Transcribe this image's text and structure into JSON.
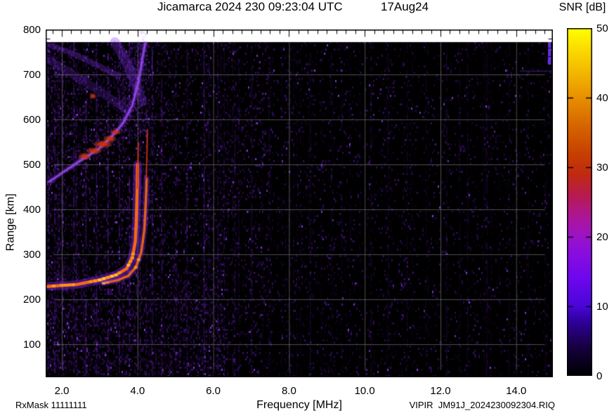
{
  "header": {
    "title": "Jicamarca 2024 230 09:23:04 UTC",
    "date": "17Aug24"
  },
  "footer": {
    "left": "RxMask 11111111",
    "right": "VIPIR  JM91J_2024230092304.RIQ"
  },
  "axes": {
    "x_label": "Frequency [MHz]",
    "y_label": "Range [km]",
    "x_tick_values": [
      2,
      4,
      6,
      8,
      10,
      12,
      14
    ],
    "x_tick_labels": [
      "2.0",
      "4.0",
      "6.0",
      "8.0",
      "10.0",
      "12.0",
      "14.0"
    ],
    "y_tick_values": [
      100,
      200,
      300,
      400,
      500,
      600,
      700,
      800
    ],
    "y_tick_labels": [
      "100",
      "200",
      "300",
      "400",
      "500",
      "600",
      "700",
      "800"
    ],
    "x_range_mhz": [
      1.57,
      14.97
    ],
    "y_range_km": [
      26.6,
      800
    ],
    "grid_color": "#7a7a7a"
  },
  "colorbar": {
    "title": "SNR [dB]",
    "min": 0,
    "max": 50,
    "tick_values": [
      0,
      10,
      20,
      30,
      40,
      50
    ],
    "tick_labels": [
      "0",
      "10",
      "20",
      "30",
      "40",
      "50"
    ],
    "palette": [
      [
        0,
        "#000000"
      ],
      [
        4,
        "#16003e"
      ],
      [
        8,
        "#31019f"
      ],
      [
        10,
        "#4a06d8"
      ],
      [
        14,
        "#6e07ee"
      ],
      [
        18,
        "#8b0edd"
      ],
      [
        20,
        "#9c13c6"
      ],
      [
        23,
        "#ad1694"
      ],
      [
        26,
        "#b81b4e"
      ],
      [
        29,
        "#c02a10"
      ],
      [
        32,
        "#c74000"
      ],
      [
        36,
        "#d66600"
      ],
      [
        40,
        "#e89000"
      ],
      [
        44,
        "#f4bc00"
      ],
      [
        47,
        "#fbdc00"
      ],
      [
        50,
        "#ffff00"
      ]
    ]
  },
  "chart_data": {
    "type": "heatmap",
    "title": "Jicamarca 2024 230 09:23:04 UTC",
    "x_unit": "MHz",
    "y_unit": "km",
    "value_unit": "dB",
    "value_range": [
      0,
      50
    ],
    "data_top_km": 772,
    "critical_frequencies": {
      "foF2_mhz": 4.0,
      "fxF2_mhz": 4.25
    },
    "colors": {
      "noise_violet": "#6e1ecd",
      "bright_violet": "#9646ff",
      "cloud_violet": "#8c37f5",
      "trace_orange": "#ff6e0e",
      "trace_hot": "#ffd24a",
      "trace_hot2": "#ff9c17",
      "trace_red": "#d73517"
    },
    "features": {
      "f_layer_o_trace": [
        [
          1.57,
          228
        ],
        [
          2.0,
          231
        ],
        [
          2.4,
          233
        ],
        [
          3.0,
          243
        ],
        [
          3.43,
          254
        ],
        [
          3.71,
          268
        ],
        [
          3.86,
          292
        ],
        [
          3.94,
          328
        ],
        [
          3.97,
          382
        ],
        [
          3.99,
          446
        ],
        [
          4.0,
          500
        ]
      ],
      "f_layer_o_tip": [
        [
          3.99,
          446
        ],
        [
          4.01,
          505
        ],
        [
          4.02,
          548
        ]
      ],
      "f_layer_x_trace": [
        [
          3.1,
          236
        ],
        [
          3.5,
          243
        ],
        [
          3.75,
          252
        ],
        [
          3.95,
          271
        ],
        [
          4.1,
          305
        ],
        [
          4.18,
          355
        ],
        [
          4.22,
          420
        ],
        [
          4.24,
          468
        ]
      ],
      "f_layer_x_tip": [
        [
          4.23,
          468
        ],
        [
          4.25,
          530
        ],
        [
          4.26,
          577
        ]
      ],
      "second_hop_edge": [
        [
          1.57,
          456
        ],
        [
          2.04,
          483
        ],
        [
          2.5,
          509
        ],
        [
          2.97,
          534
        ],
        [
          3.34,
          564
        ],
        [
          3.62,
          592
        ],
        [
          3.86,
          631
        ],
        [
          4.03,
          686
        ],
        [
          4.14,
          741
        ],
        [
          4.2,
          769
        ]
      ],
      "red_patches": [
        [
          2.6,
          518,
          10,
          5
        ],
        [
          2.85,
          530,
          12,
          5
        ],
        [
          3.08,
          545,
          14,
          6
        ],
        [
          3.27,
          557,
          10,
          5
        ],
        [
          2.82,
          652,
          5,
          4
        ],
        [
          3.42,
          572,
          8,
          4
        ]
      ],
      "diag_bands": [
        {
          "pts": [
            [
              1.57,
              768
            ],
            [
              2.2,
              750
            ],
            [
              3.0,
              718
            ],
            [
              3.5,
              697
            ]
          ],
          "w": 8,
          "a": 0.3
        },
        {
          "pts": [
            [
              1.57,
              737
            ],
            [
              2.2,
              705
            ],
            [
              2.9,
              668
            ],
            [
              3.4,
              640
            ],
            [
              3.7,
              622
            ]
          ],
          "w": 12,
          "a": 0.22
        },
        {
          "pts": [
            [
              3.4,
              772
            ],
            [
              3.7,
              730
            ],
            [
              3.95,
              680
            ],
            [
              4.12,
              640
            ]
          ],
          "w": 14,
          "a": 0.3
        }
      ],
      "asymptote_haze": {
        "f": [
          3.5,
          4.3
        ],
        "km": [
          560,
          772
        ],
        "alpha": 0.3
      },
      "rfi_columns": [
        [
          1.62,
          0.5
        ],
        [
          1.8,
          0.35
        ],
        [
          2.02,
          0.3
        ],
        [
          2.3,
          0.4
        ],
        [
          2.62,
          0.35
        ],
        [
          2.9,
          0.3
        ],
        [
          3.2,
          0.45
        ],
        [
          3.5,
          0.35
        ],
        [
          3.77,
          0.5
        ],
        [
          4.05,
          0.4
        ],
        [
          4.37,
          0.45
        ],
        [
          4.62,
          0.3
        ],
        [
          5.0,
          0.25
        ],
        [
          5.3,
          0.2
        ],
        [
          5.75,
          0.2
        ],
        [
          6.1,
          0.18
        ],
        [
          6.55,
          0.22
        ],
        [
          7.0,
          0.18
        ],
        [
          7.45,
          0.15
        ],
        [
          8.0,
          0.18
        ],
        [
          8.55,
          0.15
        ],
        [
          9.1,
          0.14
        ],
        [
          9.6,
          0.12
        ],
        [
          10.15,
          0.18
        ],
        [
          10.6,
          0.12
        ],
        [
          11.1,
          0.14
        ],
        [
          11.6,
          0.12
        ],
        [
          12.15,
          0.16
        ],
        [
          12.7,
          0.12
        ],
        [
          13.2,
          0.14
        ],
        [
          13.8,
          0.12
        ],
        [
          14.3,
          0.1
        ],
        [
          14.75,
          0.12
        ]
      ],
      "edge_streak": {
        "f": 14.88,
        "km": [
          722,
          772
        ],
        "alpha": 0.9
      },
      "h_streak": {
        "km": 709,
        "f": [
          14.1,
          14.97
        ],
        "alpha": 0.3
      }
    },
    "noise": {
      "seed": 1337
    }
  }
}
